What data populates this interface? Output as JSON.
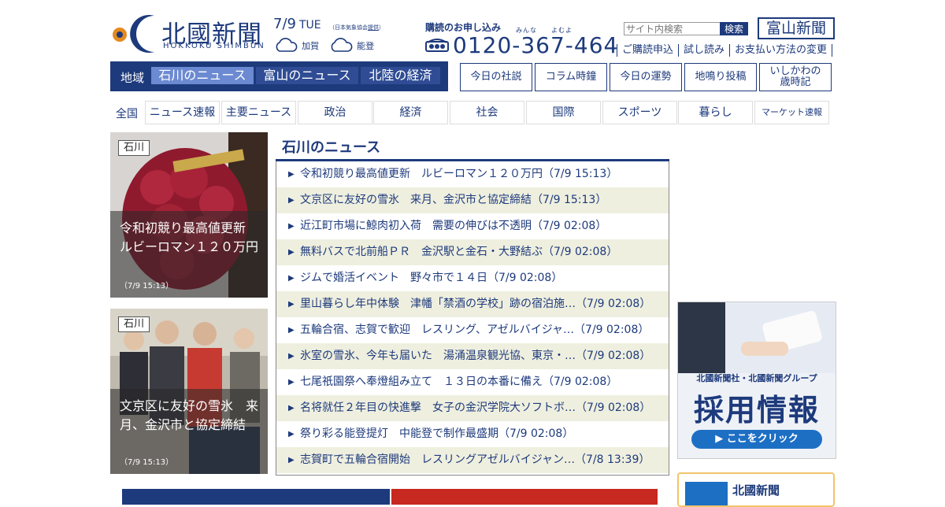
{
  "header": {
    "logo_kanji": "北國新聞",
    "logo_roman": "HOKKOKU SHIMBUN",
    "date": "7/9",
    "weekday": "TUE",
    "weather_note_prefix": "（日本気象協会",
    "weather_note_link": "提供",
    "weather_note_suffix": "）",
    "weather": [
      {
        "area": "加賀",
        "icon": "cloud-icon"
      },
      {
        "area": "能登",
        "icon": "cloud-icon"
      }
    ],
    "subscribe_title": "購読のお申し込み",
    "phone_ruby": "みんな　　よむよ",
    "phone": "0120-367-464",
    "search_placeholder": "サイト内検索",
    "search_button": "検索",
    "toyama_logo": "富山新聞",
    "sublinks": [
      "ご購読申込",
      "試し読み",
      "お支払い方法の変更"
    ]
  },
  "region_nav": {
    "label": "地域",
    "tabs": [
      "石川のニュース",
      "富山のニュース",
      "北陸の経済"
    ],
    "active": 0
  },
  "quick_links": [
    "今日の社説",
    "コラム時鐘",
    "今日の運勢",
    "地鳴り投稿",
    "いしかわの\n歳時記"
  ],
  "categories": {
    "all": "全国",
    "items": [
      "ニュース速報",
      "主要ニュース",
      "政治",
      "経済",
      "社会",
      "国際",
      "スポーツ",
      "暮らし",
      "マーケット速報"
    ]
  },
  "photos": [
    {
      "tag": "石川",
      "caption": "令和初競り最高値更新　ルビーロマン１２０万円",
      "time": "（7/9 15:13）"
    },
    {
      "tag": "石川",
      "caption": "文京区に友好の雪氷　来月、金沢市と協定締結",
      "time": "（7/9 15:13）"
    }
  ],
  "news": {
    "title": "石川のニュース",
    "items": [
      "令和初競り最高値更新　ルビーロマン１２０万円（7/9 15:13）",
      "文京区に友好の雪氷　来月、金沢市と協定締結（7/9 15:13）",
      "近江町市場に鯨肉初入荷　需要の伸びは不透明（7/9 02:08）",
      "無料バスで北前船ＰＲ　金沢駅と金石・大野結ぶ（7/9 02:08）",
      "ジムで婚活イベント　野々市で１４日（7/9 02:08）",
      "里山暮らし年中体験　津幡「禁酒の学校」跡の宿泊施…（7/9 02:08）",
      "五輪合宿、志賀で歓迎　レスリング、アゼルバイジャ…（7/9 02:08）",
      "氷室の雪氷、今年も届いた　湯涌温泉観光協、東京・…（7/9 02:08）",
      "七尾祇園祭へ奉燈組み立て　１３日の本番に備え（7/9 02:08）",
      "名将就任２年目の快進撃　女子の金沢学院大ソフトボ…（7/9 02:08）",
      "祭り彩る能登提灯　中能登で制作最盛期（7/9 02:08）",
      "志賀町で五輪合宿開始　レスリングアゼルバイジャン…（7/8 13:39）"
    ]
  },
  "ad": {
    "company": "北國新聞社・北國新聞グループ",
    "headline": "採用情報",
    "button": "▶ ここをクリック"
  },
  "ad2": {
    "title": "北國新聞"
  },
  "colors": {
    "brand": "#1d3a7c",
    "active_tab": "#6c8ad1",
    "row_alt": "#efefdf"
  }
}
